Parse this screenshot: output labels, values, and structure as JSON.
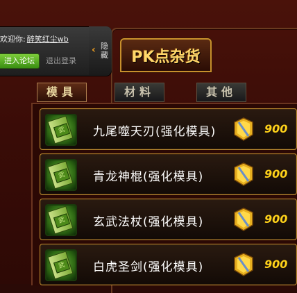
{
  "login": {
    "welcome_label": "欢迎你:",
    "username": "醉笑红尘wb",
    "forum_button": "进入论坛",
    "logout_link": "退出登录",
    "hide_label": "隐藏"
  },
  "shop": {
    "title": "PK点杂货",
    "tabs": [
      "模具",
      "材料",
      "其他"
    ],
    "active_tab": "模具",
    "items": [
      {
        "name": "九尾噬天刃(强化模具)",
        "price": "900"
      },
      {
        "name": "青龙神棍(强化模具)",
        "price": "900"
      },
      {
        "name": "玄武法杖(强化模具)",
        "price": "900"
      },
      {
        "name": "白虎圣剑(强化模具)",
        "price": "900"
      }
    ]
  },
  "icons": {
    "item_icon": "green-scroll-icon",
    "currency_icon": "gold-token-icon"
  },
  "colors": {
    "price": "#ffd21a",
    "title": "#ffd76a",
    "item_border": "#b8882e"
  }
}
